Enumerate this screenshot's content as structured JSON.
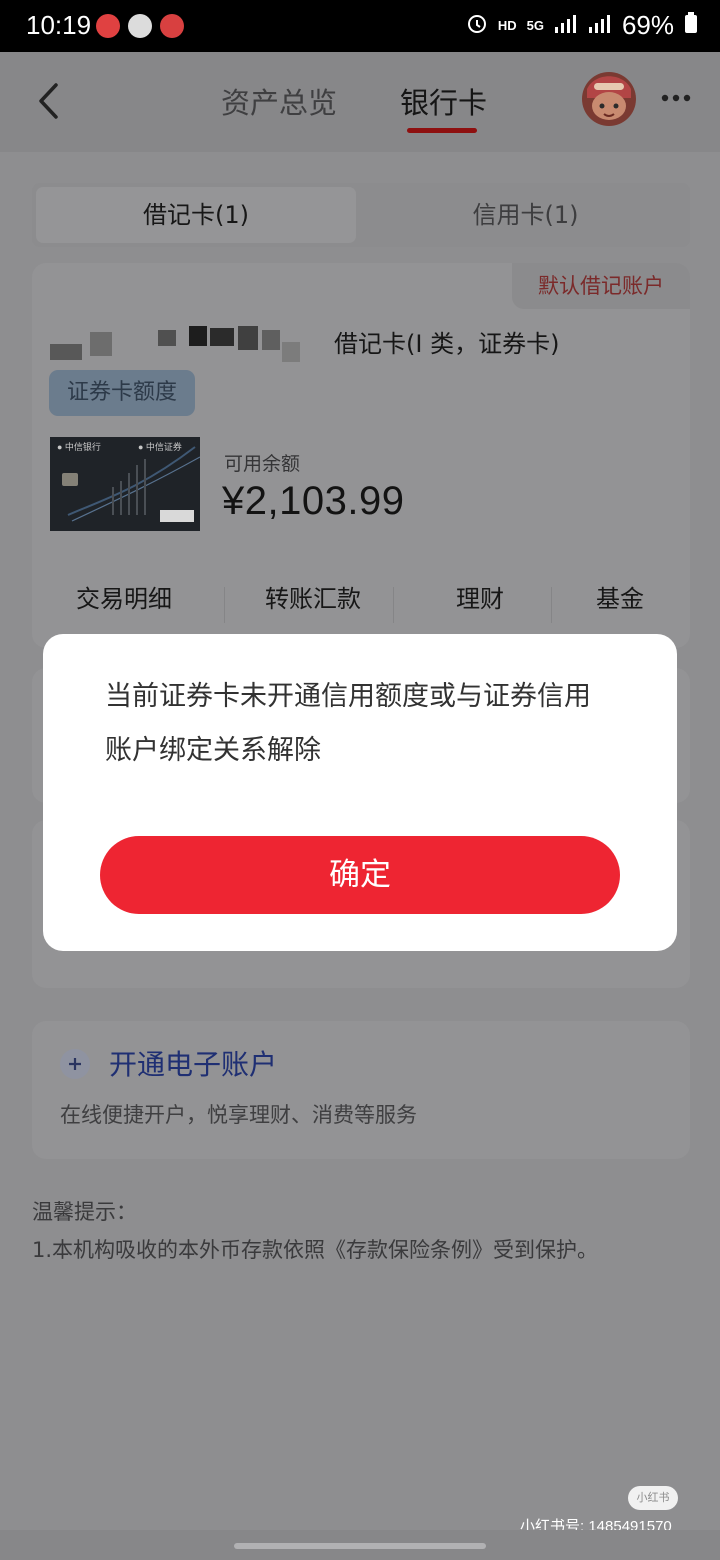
{
  "status_bar": {
    "time": "10:19",
    "signal_label_hd": "HD",
    "signal_label_5g": "5G",
    "battery": "69%"
  },
  "header": {
    "tabs": [
      {
        "label": "资产总览"
      },
      {
        "label": "银行卡"
      }
    ],
    "active_tab": "银行卡"
  },
  "card_tabs": {
    "items": [
      {
        "label": "借记卡(1)"
      },
      {
        "label": "信用卡(1)"
      }
    ],
    "active": "借记卡(1)"
  },
  "card": {
    "default_badge": "默认借记账户",
    "type_text": "借记卡(I 类，证券卡)",
    "quota_badge": "证券卡额度",
    "balance_label": "可用余额",
    "balance_value": "¥2,103.99",
    "actions": [
      "交易明细",
      "转账汇款",
      "理财",
      "基金"
    ]
  },
  "open_account": {
    "title": "开通电子账户",
    "subtitle": "在线便捷开户，悦享理财、消费等服务"
  },
  "tips": {
    "title": "温馨提示：",
    "text": "1.本机构吸收的本外币存款依照《存款保险条例》受到保护。"
  },
  "modal": {
    "message": "当前证券卡未开通信用额度或与证券信用账户绑定关系解除",
    "confirm_label": "确定"
  },
  "watermark": {
    "logo": "小红书",
    "id_text": "小红书号: 1485491570"
  },
  "colors": {
    "overlay_bg": "#8e8e90",
    "modal_bg": "#ffffff",
    "primary_button": "#ee2532",
    "underline": "#8e1010"
  }
}
